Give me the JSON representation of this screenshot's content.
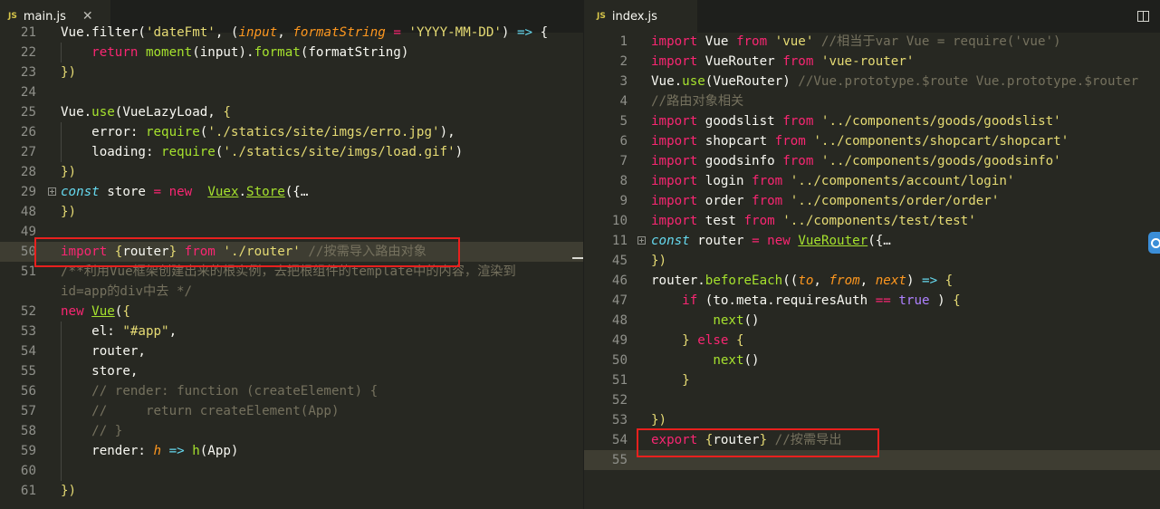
{
  "left_tab": {
    "badge": "JS",
    "filename": "main.js",
    "close": "✕"
  },
  "right_tab": {
    "badge": "JS",
    "filename": "index.js"
  },
  "left_lines": [
    {
      "n": "21",
      "tokens": [
        [
          "",
          "Vue.filter("
        ],
        [
          "st",
          "'dateFmt'"
        ],
        [
          "",
          ", ("
        ],
        [
          "pa",
          "input"
        ],
        [
          "",
          ", "
        ],
        [
          "pa",
          "formatString"
        ],
        [
          "kw",
          " = "
        ],
        [
          "st",
          "'YYYY-MM-DD'"
        ],
        [
          "",
          ") "
        ],
        [
          "ty",
          "=>"
        ],
        [
          "",
          " {"
        ]
      ]
    },
    {
      "n": "22",
      "tokens": [
        [
          "",
          "    "
        ],
        [
          "kw",
          "return"
        ],
        [
          "fn",
          " moment"
        ],
        [
          "",
          "(input)."
        ],
        [
          "fn",
          "format"
        ],
        [
          "",
          "(formatString)"
        ]
      ]
    },
    {
      "n": "23",
      "tokens": [
        [
          "br",
          "})"
        ]
      ]
    },
    {
      "n": "24",
      "tokens": []
    },
    {
      "n": "25",
      "tokens": [
        [
          "",
          "Vue."
        ],
        [
          "fn",
          "use"
        ],
        [
          "",
          "(VueLazyLoad, "
        ],
        [
          "br",
          "{"
        ]
      ]
    },
    {
      "n": "26",
      "tokens": [
        [
          "",
          "    error: "
        ],
        [
          "fn",
          "require"
        ],
        [
          "",
          "("
        ],
        [
          "st",
          "'./statics/site/imgs/erro.jpg'"
        ],
        [
          "",
          "),"
        ]
      ]
    },
    {
      "n": "27",
      "tokens": [
        [
          "",
          "    loading: "
        ],
        [
          "fn",
          "require"
        ],
        [
          "",
          "("
        ],
        [
          "st",
          "'./statics/site/imgs/load.gif'"
        ],
        [
          "",
          ")"
        ]
      ]
    },
    {
      "n": "28",
      "tokens": [
        [
          "br",
          "})"
        ]
      ]
    },
    {
      "n": "29",
      "tokens": [
        [
          "ty",
          "const"
        ],
        [
          "",
          " store "
        ],
        [
          "kw",
          "="
        ],
        [
          "kw",
          " new"
        ],
        [
          "",
          "  "
        ],
        [
          "fnu",
          "Vuex"
        ],
        [
          "",
          "."
        ],
        [
          "fnu",
          "Store"
        ],
        [
          "",
          "({"
        ],
        [
          "",
          "…"
        ]
      ],
      "fold": true
    },
    {
      "n": "48",
      "tokens": [
        [
          "br",
          "})"
        ]
      ]
    },
    {
      "n": "49",
      "tokens": []
    },
    {
      "n": "50",
      "tokens": [
        [
          "kw",
          "import"
        ],
        [
          "",
          " "
        ],
        [
          "br",
          "{"
        ],
        [
          "",
          "router"
        ],
        [
          "br",
          "}"
        ],
        [
          "kw",
          " from"
        ],
        [
          "st",
          " './router'"
        ],
        [
          "cm",
          " //按需导入路由对象"
        ]
      ],
      "current": true
    },
    {
      "n": "51",
      "tokens": [
        [
          "cm",
          "/**利用Vue框架创建出来的根实例，去把根组件的template中的内容，渲染到"
        ]
      ]
    },
    {
      "n": "",
      "tokens": [
        [
          "cm",
          "id=app的div中去 */"
        ]
      ]
    },
    {
      "n": "52",
      "tokens": [
        [
          "kw",
          "new"
        ],
        [
          "",
          " "
        ],
        [
          "fnu",
          "Vue"
        ],
        [
          "",
          "("
        ],
        [
          "br",
          "{"
        ]
      ]
    },
    {
      "n": "53",
      "tokens": [
        [
          "",
          "    el: "
        ],
        [
          "st",
          "\"#app\""
        ],
        [
          "",
          ","
        ]
      ]
    },
    {
      "n": "54",
      "tokens": [
        [
          "",
          "    router,"
        ]
      ]
    },
    {
      "n": "55",
      "tokens": [
        [
          "",
          "    store,"
        ]
      ]
    },
    {
      "n": "56",
      "tokens": [
        [
          "cm",
          "    // render: function (createElement) {"
        ]
      ]
    },
    {
      "n": "57",
      "tokens": [
        [
          "cm",
          "    //     return createElement(App)"
        ]
      ]
    },
    {
      "n": "58",
      "tokens": [
        [
          "cm",
          "    // }"
        ]
      ]
    },
    {
      "n": "59",
      "tokens": [
        [
          "",
          "    render: "
        ],
        [
          "pa",
          "h"
        ],
        [
          "ty",
          " =>"
        ],
        [
          "fn",
          " h"
        ],
        [
          "",
          "(App)"
        ]
      ]
    },
    {
      "n": "60",
      "tokens": []
    },
    {
      "n": "61",
      "tokens": [
        [
          "br",
          "})"
        ]
      ]
    }
  ],
  "right_lines": [
    {
      "n": "1",
      "tokens": [
        [
          "kw",
          "import"
        ],
        [
          "",
          " Vue "
        ],
        [
          "kw",
          "from"
        ],
        [
          "st",
          " 'vue'"
        ],
        [
          "cm",
          " //相当于var Vue = require('vue')"
        ]
      ]
    },
    {
      "n": "2",
      "tokens": [
        [
          "kw",
          "import"
        ],
        [
          "",
          " VueRouter "
        ],
        [
          "kw",
          "from"
        ],
        [
          "st",
          " 'vue-router'"
        ]
      ]
    },
    {
      "n": "3",
      "tokens": [
        [
          "",
          "Vue."
        ],
        [
          "fn",
          "use"
        ],
        [
          "",
          "(VueRouter)"
        ],
        [
          "cm",
          " //Vue.prototype.$route Vue.prototype.$router"
        ]
      ]
    },
    {
      "n": "4",
      "tokens": [
        [
          "cm",
          "//路由对象相关"
        ]
      ]
    },
    {
      "n": "5",
      "tokens": [
        [
          "kw",
          "import"
        ],
        [
          "",
          " goodslist "
        ],
        [
          "kw",
          "from"
        ],
        [
          "st",
          " '../components/goods/goodslist'"
        ]
      ]
    },
    {
      "n": "6",
      "tokens": [
        [
          "kw",
          "import"
        ],
        [
          "",
          " shopcart "
        ],
        [
          "kw",
          "from"
        ],
        [
          "st",
          " '../components/shopcart/shopcart'"
        ]
      ]
    },
    {
      "n": "7",
      "tokens": [
        [
          "kw",
          "import"
        ],
        [
          "",
          " goodsinfo "
        ],
        [
          "kw",
          "from"
        ],
        [
          "st",
          " '../components/goods/goodsinfo'"
        ]
      ]
    },
    {
      "n": "8",
      "tokens": [
        [
          "kw",
          "import"
        ],
        [
          "",
          " login "
        ],
        [
          "kw",
          "from"
        ],
        [
          "st",
          " '../components/account/login'"
        ]
      ]
    },
    {
      "n": "9",
      "tokens": [
        [
          "kw",
          "import"
        ],
        [
          "",
          " order "
        ],
        [
          "kw",
          "from"
        ],
        [
          "st",
          " '../components/order/order'"
        ]
      ]
    },
    {
      "n": "10",
      "tokens": [
        [
          "kw",
          "import"
        ],
        [
          "",
          " test "
        ],
        [
          "kw",
          "from"
        ],
        [
          "st",
          " '../components/test/test'"
        ]
      ]
    },
    {
      "n": "11",
      "tokens": [
        [
          "ty",
          "const"
        ],
        [
          "",
          " router "
        ],
        [
          "kw",
          "="
        ],
        [
          "kw",
          " new"
        ],
        [
          "",
          " "
        ],
        [
          "fnu",
          "VueRouter"
        ],
        [
          "",
          "({"
        ],
        [
          "",
          "…"
        ]
      ],
      "fold": true
    },
    {
      "n": "45",
      "tokens": [
        [
          "br",
          "})"
        ]
      ]
    },
    {
      "n": "46",
      "tokens": [
        [
          "",
          "router."
        ],
        [
          "fn",
          "beforeEach"
        ],
        [
          "",
          "(("
        ],
        [
          "pa",
          "to"
        ],
        [
          "",
          ", "
        ],
        [
          "pa",
          "from"
        ],
        [
          "",
          ", "
        ],
        [
          "pa",
          "next"
        ],
        [
          "",
          ") "
        ],
        [
          "ty",
          "=>"
        ],
        [
          "br",
          " {"
        ]
      ]
    },
    {
      "n": "47",
      "tokens": [
        [
          "",
          "    "
        ],
        [
          "kw",
          "if"
        ],
        [
          "",
          " (to.meta.requiresAuth "
        ],
        [
          "kw",
          "=="
        ],
        [
          "bo",
          " true"
        ],
        [
          "",
          " ) "
        ],
        [
          "br",
          "{"
        ]
      ]
    },
    {
      "n": "48",
      "tokens": [
        [
          "",
          "        "
        ],
        [
          "fn",
          "next"
        ],
        [
          "",
          "()"
        ]
      ]
    },
    {
      "n": "49",
      "tokens": [
        [
          "",
          "    "
        ],
        [
          "br",
          "}"
        ],
        [
          "kw",
          " else"
        ],
        [
          "",
          " "
        ],
        [
          "br",
          "{"
        ]
      ]
    },
    {
      "n": "50",
      "tokens": [
        [
          "",
          "        "
        ],
        [
          "fn",
          "next"
        ],
        [
          "",
          "()"
        ]
      ]
    },
    {
      "n": "51",
      "tokens": [
        [
          "",
          "    "
        ],
        [
          "br",
          "}"
        ]
      ]
    },
    {
      "n": "52",
      "tokens": []
    },
    {
      "n": "53",
      "tokens": [
        [
          "br",
          "})"
        ]
      ]
    },
    {
      "n": "54",
      "tokens": [
        [
          "kw",
          "export"
        ],
        [
          "",
          " "
        ],
        [
          "br",
          "{"
        ],
        [
          "",
          "router"
        ],
        [
          "br",
          "}"
        ],
        [
          "cm",
          " //按需导出"
        ]
      ]
    },
    {
      "n": "55",
      "tokens": [],
      "current": true
    }
  ]
}
